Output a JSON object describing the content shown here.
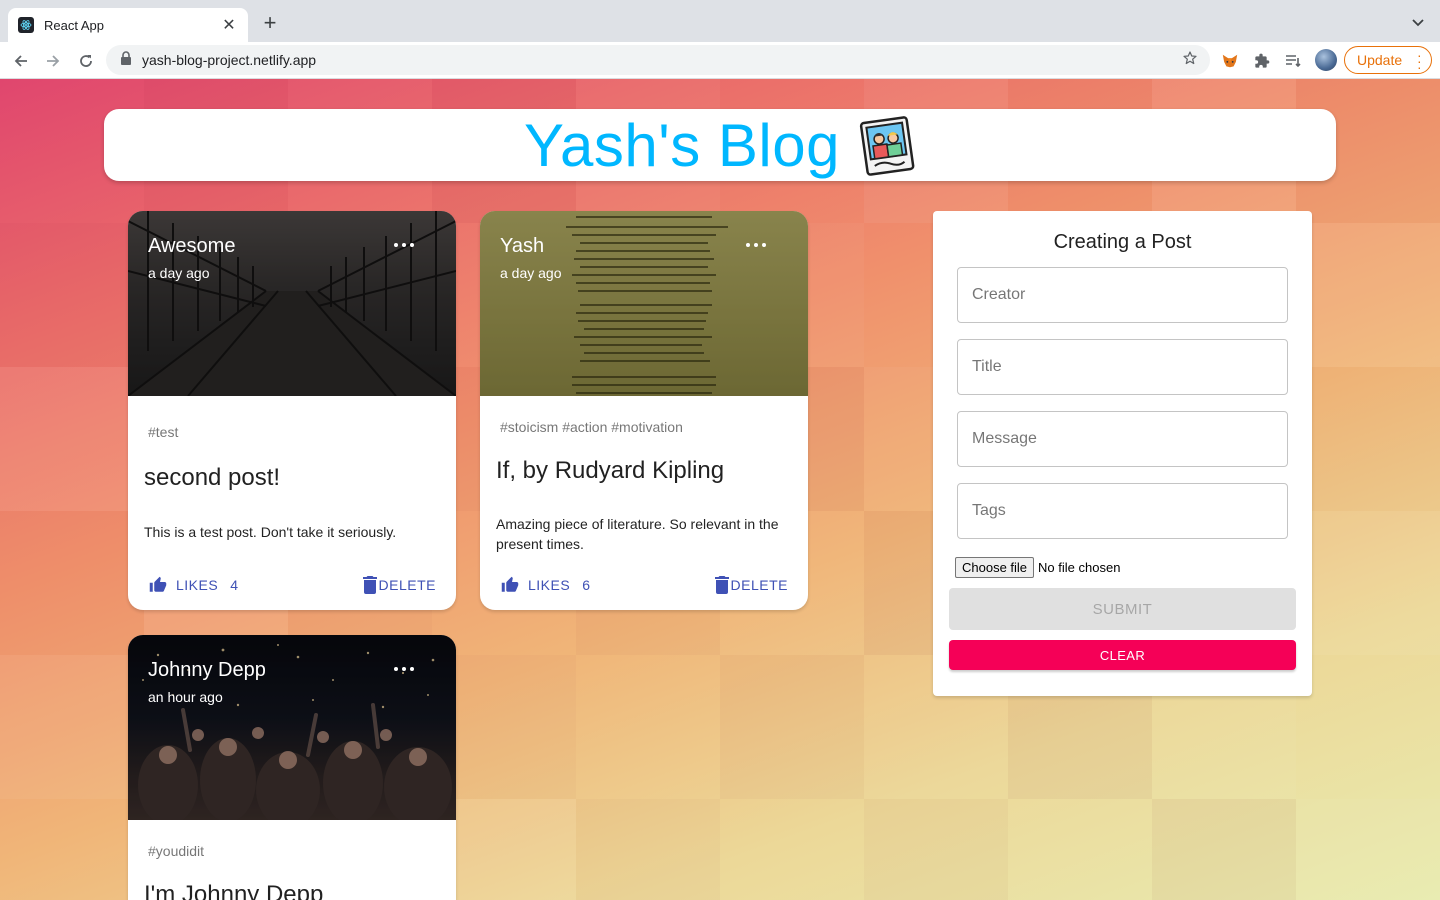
{
  "browser": {
    "tab_title": "React App",
    "url": "yash-blog-project.netlify.app",
    "update_label": "Update"
  },
  "app": {
    "heading": "Yash's Blog"
  },
  "posts": [
    {
      "creator": "Awesome",
      "time": "a day ago",
      "tags": "#test",
      "title": "second post!",
      "message": "This is a test post. Don't take it seriously.",
      "like_label": "LIKES",
      "like_count": "4",
      "delete_label": "DELETE"
    },
    {
      "creator": "Yash",
      "time": "a day ago",
      "tags": "#stoicism #action #motivation",
      "title": "If, by Rudyard Kipling",
      "message": "Amazing piece of literature. So relevant in the present times.",
      "like_label": "LIKES",
      "like_count": "6",
      "delete_label": "DELETE"
    },
    {
      "creator": "Johnny Depp",
      "time": "an hour ago",
      "tags": "#youdidit",
      "title": "I'm Johnny Depp"
    }
  ],
  "form": {
    "title": "Creating a Post",
    "creator_placeholder": "Creator",
    "title_placeholder": "Title",
    "message_placeholder": "Message",
    "tags_placeholder": "Tags",
    "file_button": "Choose file",
    "file_status": "No file chosen",
    "submit_label": "SUBMIT",
    "clear_label": "CLEAR"
  },
  "colors": {
    "heading": "#00b7ff",
    "action": "#3f51b5",
    "clear": "#f50057",
    "update": "#e8710a"
  }
}
